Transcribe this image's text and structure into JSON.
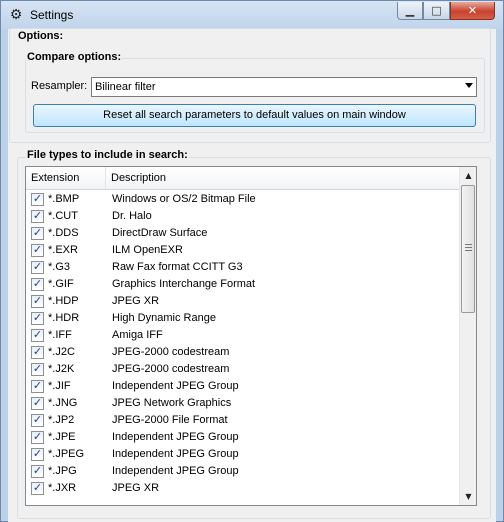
{
  "window": {
    "title": "Settings",
    "min_glyph": "▁",
    "max_glyph": "□",
    "close_glyph": "✕"
  },
  "options": {
    "group_label": "Options:",
    "compare": {
      "group_label": "Compare options:",
      "resampler_label": "Resampler:",
      "resampler_value": "Bilinear filter",
      "reset_button": "Reset all search parameters to default values on main window"
    }
  },
  "file_types": {
    "group_label": "File types to include in search:",
    "columns": [
      "Extension",
      "Description"
    ],
    "rows": [
      {
        "ext": "*.BMP",
        "desc": "Windows or OS/2 Bitmap File",
        "checked": true
      },
      {
        "ext": "*.CUT",
        "desc": "Dr. Halo",
        "checked": true
      },
      {
        "ext": "*.DDS",
        "desc": "DirectDraw Surface",
        "checked": true
      },
      {
        "ext": "*.EXR",
        "desc": "ILM OpenEXR",
        "checked": true
      },
      {
        "ext": "*.G3",
        "desc": "Raw Fax format CCITT G3",
        "checked": true
      },
      {
        "ext": "*.GIF",
        "desc": "Graphics Interchange Format",
        "checked": true
      },
      {
        "ext": "*.HDP",
        "desc": "JPEG XR",
        "checked": true
      },
      {
        "ext": "*.HDR",
        "desc": "High Dynamic Range",
        "checked": true
      },
      {
        "ext": "*.IFF",
        "desc": "Amiga IFF",
        "checked": true
      },
      {
        "ext": "*.J2C",
        "desc": "JPEG-2000 codestream",
        "checked": true
      },
      {
        "ext": "*.J2K",
        "desc": "JPEG-2000 codestream",
        "checked": true
      },
      {
        "ext": "*.JIF",
        "desc": "Independent JPEG Group",
        "checked": true
      },
      {
        "ext": "*.JNG",
        "desc": "JPEG Network Graphics",
        "checked": true
      },
      {
        "ext": "*.JP2",
        "desc": "JPEG-2000 File Format",
        "checked": true
      },
      {
        "ext": "*.JPE",
        "desc": "Independent JPEG Group",
        "checked": true
      },
      {
        "ext": "*.JPEG",
        "desc": "Independent JPEG Group",
        "checked": true
      },
      {
        "ext": "*.JPG",
        "desc": "Independent JPEG Group",
        "checked": true
      },
      {
        "ext": "*.JXR",
        "desc": "JPEG XR",
        "checked": true
      }
    ],
    "check_glyph": "✓",
    "scroll_up_glyph": "▲",
    "scroll_down_glyph": "▼"
  }
}
